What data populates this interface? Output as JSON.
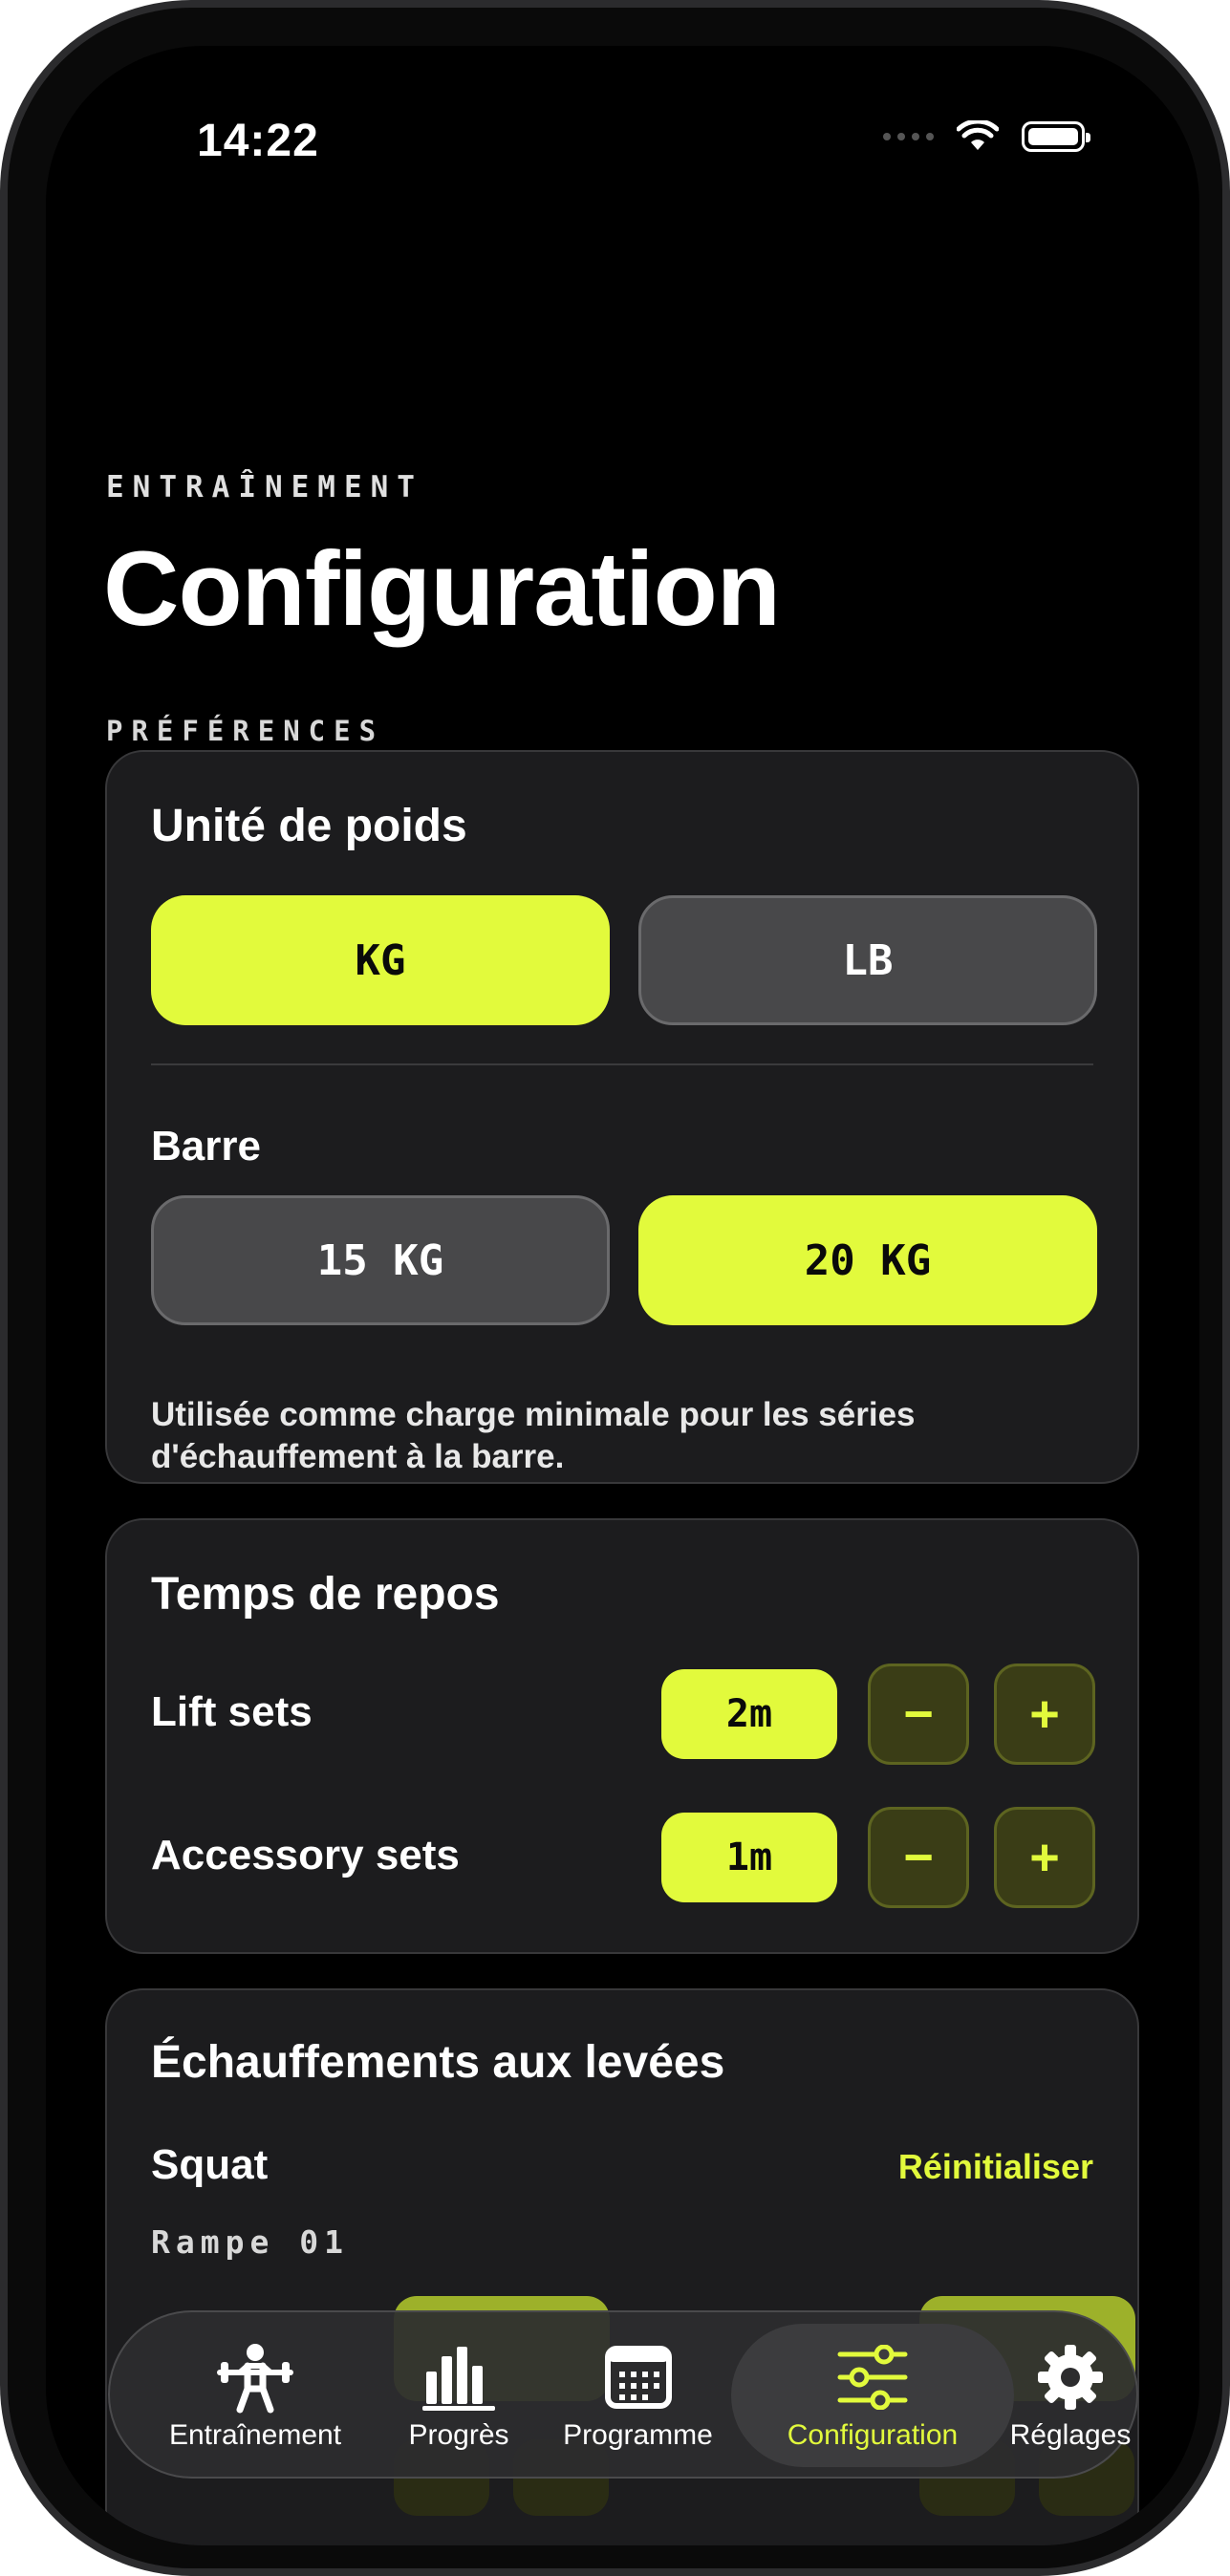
{
  "status": {
    "time": "14:22"
  },
  "header": {
    "eyebrow": "ENTRAÎNEMENT",
    "title": "Configuration",
    "section": "PRÉFÉRENCES"
  },
  "weight_unit": {
    "title": "Unité de poids",
    "options": [
      "KG",
      "LB"
    ],
    "selected": "KG"
  },
  "bar": {
    "title": "Barre",
    "options": [
      "15 KG",
      "20 KG"
    ],
    "selected": "20 KG",
    "help": "Utilisée comme charge minimale pour les séries d'échauffement à la barre."
  },
  "rest": {
    "title": "Temps de repos",
    "rows": [
      {
        "label": "Lift sets",
        "value": "2m",
        "minus": "−",
        "plus": "+"
      },
      {
        "label": "Accessory sets",
        "value": "1m",
        "minus": "−",
        "plus": "+"
      }
    ]
  },
  "warmups": {
    "title": "Échauffements aux levées",
    "lift": "Squat",
    "reset": "Réinitialiser",
    "ramp": "Rampe 01"
  },
  "tabs": [
    {
      "label": "Entraînement",
      "icon": "weightlifter-icon"
    },
    {
      "label": "Progrès",
      "icon": "bar-chart-icon"
    },
    {
      "label": "Programme",
      "icon": "calendar-icon"
    },
    {
      "label": "Configuration",
      "icon": "sliders-icon",
      "active": true
    },
    {
      "label": "Réglages",
      "icon": "gear-icon"
    }
  ],
  "colors": {
    "accent": "#e2fa3c",
    "background": "#000000",
    "card": "#1c1c1e"
  }
}
